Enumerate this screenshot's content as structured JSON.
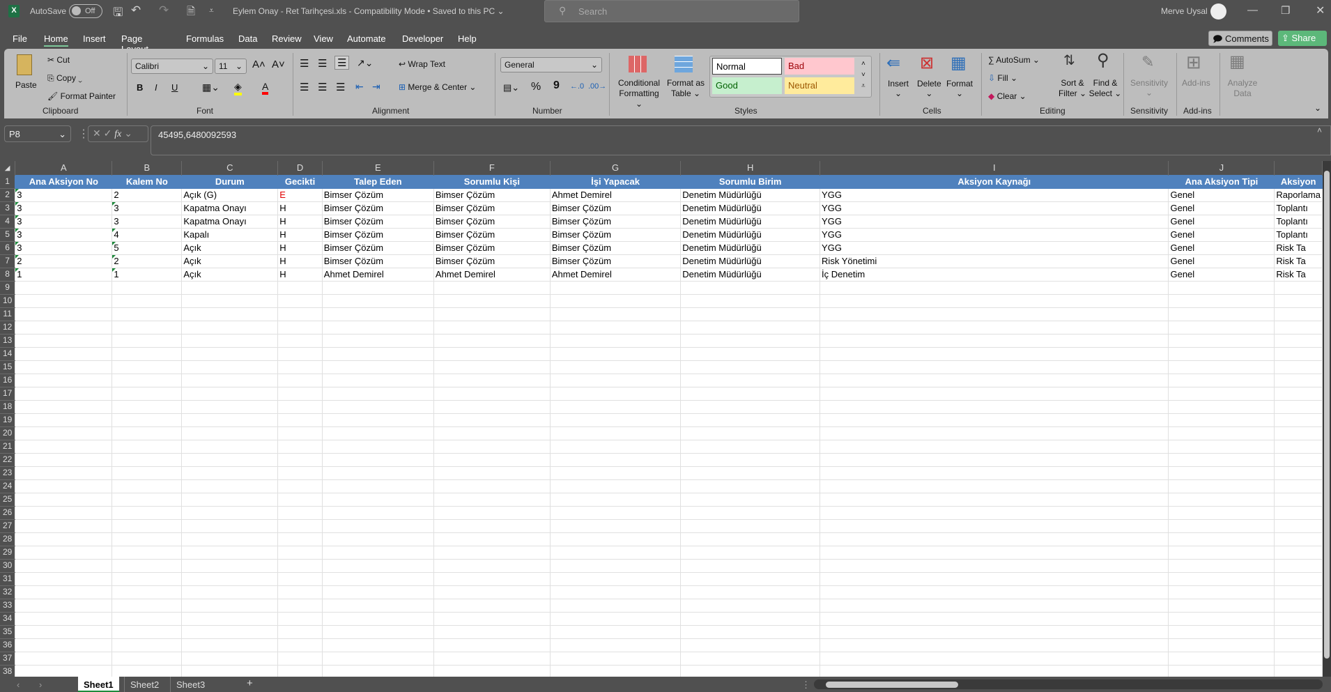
{
  "titlebar": {
    "autosave_label": "AutoSave",
    "autosave_state": "Off",
    "doc_title": "Eylem Onay - Ret Tarihçesi.xls  -  Compatibility Mode • Saved to this PC ⌄",
    "search_placeholder": "Search",
    "user": "Merve Uysal",
    "icons": [
      "excel-logo",
      "save-icon",
      "undo-icon",
      "redo-icon",
      "document-icon",
      "customize-icon"
    ]
  },
  "menu": {
    "tabs": [
      "File",
      "Home",
      "Insert",
      "Page Layout",
      "Formulas",
      "Data",
      "Review",
      "View",
      "Automate",
      "Developer",
      "Help"
    ],
    "active": "Home",
    "comments": "Comments",
    "share": "Share"
  },
  "ribbon": {
    "clipboard": {
      "paste": "Paste",
      "cut": "Cut",
      "copy": "Copy",
      "format_painter": "Format Painter",
      "label": "Clipboard"
    },
    "font": {
      "name": "Calibri",
      "size": "11",
      "bold": "B",
      "italic": "I",
      "underline": "U",
      "label": "Font",
      "fill_color": "#ffff00",
      "font_color": "#ff0000"
    },
    "alignment": {
      "wrap": "Wrap Text",
      "merge": "Merge & Center",
      "label": "Alignment"
    },
    "number": {
      "format": "General",
      "percent": "%",
      "comma": "9",
      "label": "Number"
    },
    "styles": {
      "conditional": "Conditional Formatting ⌄",
      "format_table": "Format as Table ⌄",
      "normal": "Normal",
      "bad": "Bad",
      "good": "Good",
      "neutral": "Neutral",
      "label": "Styles"
    },
    "cells": {
      "insert": "Insert",
      "delete": "Delete",
      "format": "Format",
      "label": "Cells"
    },
    "editing": {
      "autosum": "AutoSum",
      "fill": "Fill ⌄",
      "clear": "Clear ⌄",
      "sort": "Sort & Filter ⌄",
      "find": "Find & Select ⌄",
      "label": "Editing"
    },
    "sensitivity": {
      "button": "Sensitivity",
      "label": "Sensitivity"
    },
    "addins": {
      "button": "Add-ins",
      "label": "Add-ins"
    },
    "analyze": {
      "button": "Analyze Data"
    }
  },
  "formula_bar": {
    "name_box": "P8",
    "formula": "45495,6480092593"
  },
  "sheet": {
    "columns": [
      "A",
      "B",
      "C",
      "D",
      "E",
      "F",
      "G",
      "H",
      "I",
      "J",
      ""
    ],
    "header_row": [
      "Ana Aksiyon No",
      "Kalem No",
      "Durum",
      "Gecikti",
      "Talep Eden",
      "Sorumlu Kişi",
      "İşi Yapacak",
      "Sorumlu Birim",
      "Aksiyon Kaynağı",
      "Ana Aksiyon Tipi",
      "Aksiyon"
    ],
    "rows": [
      [
        "3",
        "2",
        "Açık (G)",
        "E",
        "Bimser Çözüm",
        "Bimser Çözüm",
        "Ahmet Demirel",
        "Denetim Müdürlüğü",
        "YGG",
        "Genel",
        "Raporlama"
      ],
      [
        "3",
        "3",
        "Kapatma Onayı",
        "H",
        "Bimser Çözüm",
        "Bimser Çözüm",
        "Bimser Çözüm",
        "Denetim Müdürlüğü",
        "YGG",
        "Genel",
        "Toplantı"
      ],
      [
        "3",
        "3",
        "Kapatma Onayı",
        "H",
        "Bimser Çözüm",
        "Bimser Çözüm",
        "Bimser Çözüm",
        "Denetim Müdürlüğü",
        "YGG",
        "Genel",
        "Toplantı"
      ],
      [
        "3",
        "4",
        "Kapalı",
        "H",
        "Bimser Çözüm",
        "Bimser Çözüm",
        "Bimser Çözüm",
        "Denetim Müdürlüğü",
        "YGG",
        "Genel",
        "Toplantı"
      ],
      [
        "3",
        "5",
        "Açık",
        "H",
        "Bimser Çözüm",
        "Bimser Çözüm",
        "Bimser Çözüm",
        "Denetim Müdürlüğü",
        "YGG",
        "Genel",
        "Risk Ta"
      ],
      [
        "2",
        "2",
        "Açık",
        "H",
        "Bimser Çözüm",
        "Bimser Çözüm",
        "Bimser Çözüm",
        "Denetim Müdürlüğü",
        "Risk Yönetimi",
        "Genel",
        "Risk Ta"
      ],
      [
        "1",
        "1",
        "Açık",
        "H",
        "Ahmet Demirel",
        "Ahmet Demirel",
        "Ahmet Demirel",
        "Denetim Müdürlüğü",
        "İç Denetim",
        "Genel",
        "Risk Ta"
      ]
    ],
    "number_as_text_flags": [
      [
        true,
        false
      ],
      [
        true,
        true
      ],
      [
        true,
        false
      ],
      [
        true,
        true
      ],
      [
        true,
        true
      ],
      [
        true,
        true
      ],
      [
        true,
        true
      ]
    ],
    "late_color": "#e00000",
    "header_color": "#4f81bd",
    "visible_rows": 38,
    "tabs": [
      "Sheet1",
      "Sheet2",
      "Sheet3"
    ],
    "active_tab": "Sheet1",
    "add_sheet": "+"
  }
}
